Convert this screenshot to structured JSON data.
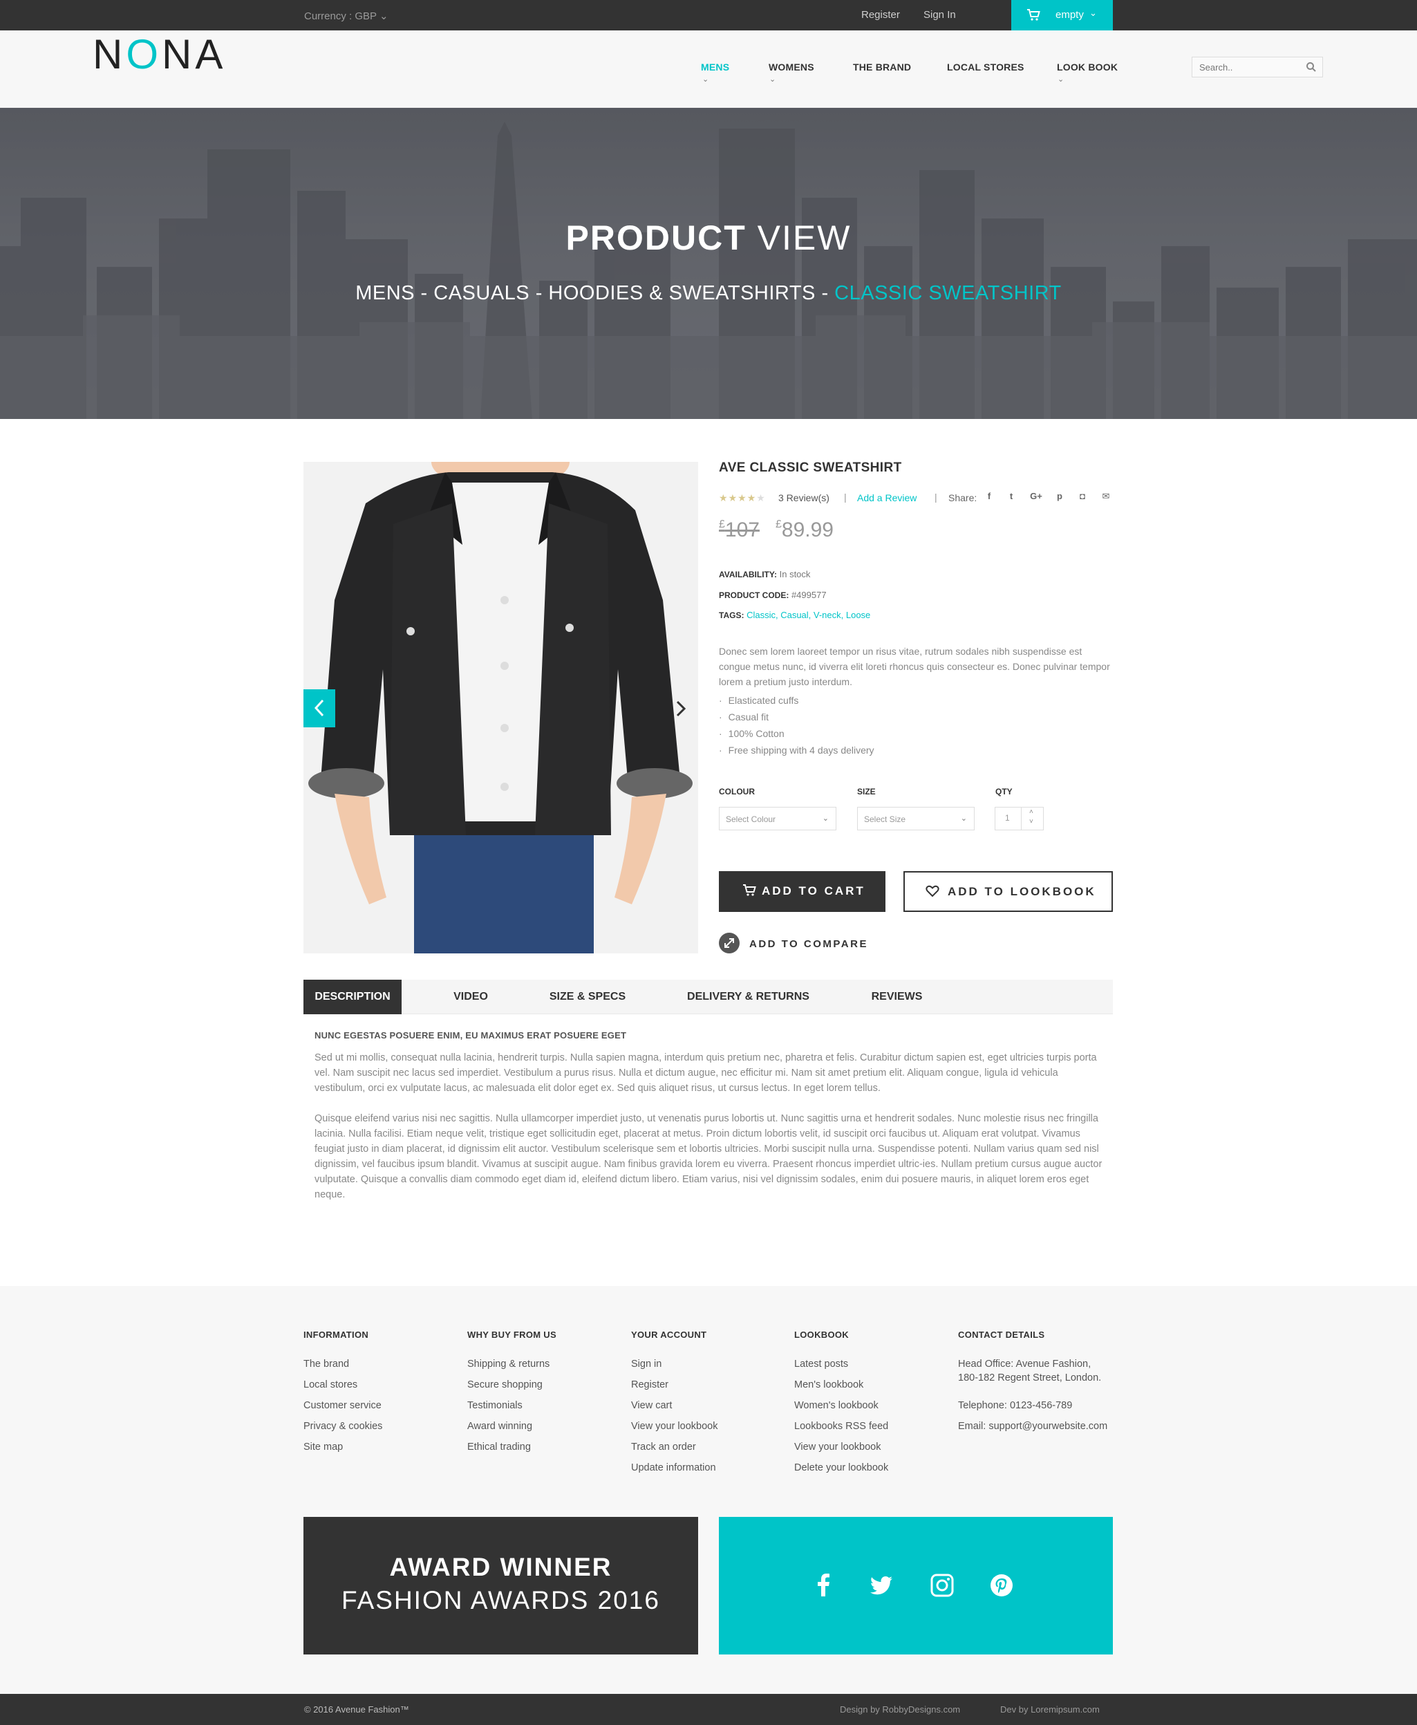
{
  "topbar": {
    "currency": "Currency : GBP",
    "register": "Register",
    "signin": "Sign In",
    "cart_label": "empty"
  },
  "header": {
    "logo": {
      "pre": "N",
      "o": "O",
      "post": "NA"
    },
    "nav": [
      {
        "label": "MENS",
        "active": true,
        "dropdown": true
      },
      {
        "label": "WOMENS",
        "active": false,
        "dropdown": true
      },
      {
        "label": "THE BRAND",
        "active": false,
        "dropdown": false
      },
      {
        "label": "LOCAL STORES",
        "active": false,
        "dropdown": false
      },
      {
        "label": "LOOK BOOK",
        "active": false,
        "dropdown": true
      }
    ],
    "search_placeholder": "Search.."
  },
  "hero": {
    "title_bold": "PRODUCT",
    "title_light": " VIEW",
    "breadcrumb": "MENS - CASUALS - HOODIES & SWEATSHIRTS - ",
    "breadcrumb_current": "CLASSIC SWEATSHIRT"
  },
  "product": {
    "title": "AVE CLASSIC SWEATSHIRT",
    "rating": 4,
    "rating_max": 5,
    "review_count": "3 Review(s)",
    "add_review": "Add a Review",
    "share_label": "Share:",
    "share_icons": [
      "facebook-icon",
      "twitter-icon",
      "google-plus-icon",
      "pinterest-icon",
      "instagram-icon",
      "email-icon"
    ],
    "share_glyphs": [
      "f",
      "t",
      "G+",
      "p",
      "◘",
      "✉"
    ],
    "currency_symbol": "£",
    "old_price": "107",
    "new_price": "89.99",
    "availability_label": "AVAILABILITY:",
    "availability_value": " In stock",
    "code_label": "PRODUCT CODE:",
    "code_value": " #499577",
    "tags_label": "TAGS:",
    "tags": "Classic, Casual, V-neck, Loose",
    "description": "Donec sem lorem laoreet tempor un risus vitae, rutrum sodales nibh suspendisse est congue metus nunc, id viverra elit loreti rhoncus quis consecteur es. Donec pulvinar tempor lorem a pretium justo interdum.",
    "features": [
      "Elasticated cuffs",
      "Casual fit",
      "100% Cotton",
      "Free shipping with 4 days delivery"
    ],
    "colour_label": "COLOUR",
    "colour_placeholder": "Select Colour",
    "size_label": "SIZE",
    "size_placeholder": "Select Size",
    "qty_label": "QTY",
    "qty_value": "1",
    "add_to_cart": "ADD TO CART",
    "add_to_lookbook": "ADD TO LOOKBOOK",
    "add_to_compare": "ADD TO COMPARE"
  },
  "tabs": [
    {
      "label": "DESCRIPTION",
      "active": true
    },
    {
      "label": "VIDEO",
      "active": false
    },
    {
      "label": "SIZE & SPECS",
      "active": false
    },
    {
      "label": "DELIVERY & RETURNS",
      "active": false
    },
    {
      "label": "REVIEWS",
      "active": false
    }
  ],
  "description_tab": {
    "heading": "NUNC EGESTAS POSUERE ENIM, EU MAXIMUS ERAT POSUERE EGET",
    "para1": "Sed ut mi mollis, consequat nulla lacinia, hendrerit turpis. Nulla sapien magna, interdum quis pretium nec, pharetra et felis. Curabitur dictum sapien est, eget ultricies turpis porta vel. Nam suscipit nec lacus sed imperdiet. Vestibulum a purus risus. Nulla et dictum augue, nec efficitur mi. Nam sit amet pretium elit. Aliquam congue, ligula id vehicula vestibulum, orci ex vulputate lacus, ac malesuada elit dolor eget ex. Sed quis aliquet risus, ut cursus lectus. In eget lorem tellus.",
    "para2": "Quisque eleifend varius nisi nec sagittis. Nulla ullamcorper imperdiet justo, ut venenatis purus lobortis ut. Nunc sagittis urna et hendrerit sodales. Nunc molestie risus nec fringilla lacinia. Nulla facilisi. Etiam neque velit, tristique eget sollicitudin eget, placerat at metus. Proin dictum lobortis velit, id suscipit orci faucibus ut. Aliquam erat volutpat. Vivamus feugiat justo in diam placerat, id dignissim elit auctor. Vestibulum scelerisque sem et lobortis ultricies. Morbi suscipit nulla urna. Suspendisse potenti. Nullam varius quam sed nisl dignissim, vel faucibus ipsum blandit. Vivamus at suscipit augue. Nam finibus gravida lorem eu viverra. Praesent rhoncus imperdiet ultric-ies. Nullam pretium cursus augue auctor vulputate. Quisque a convallis diam commodo eget diam id, eleifend dictum libero. Etiam varius, nisi vel dignissim sodales, enim dui posuere mauris, in aliquet lorem eros eget neque."
  },
  "footer": {
    "columns": [
      {
        "title": "INFORMATION",
        "links": [
          "The brand",
          "Local stores",
          "Customer service",
          "Privacy & cookies",
          "Site map"
        ]
      },
      {
        "title": "WHY BUY FROM US",
        "links": [
          "Shipping & returns",
          "Secure shopping",
          "Testimonials",
          "Award winning",
          "Ethical trading"
        ]
      },
      {
        "title": "YOUR ACCOUNT",
        "links": [
          "Sign in",
          "Register",
          "View cart",
          "View your lookbook",
          "Track an order",
          "Update information"
        ]
      },
      {
        "title": "LOOKBOOK",
        "links": [
          "Latest posts",
          "Men's lookbook",
          "Women's lookbook",
          "Lookbooks RSS feed",
          "View your lookbook",
          "Delete your lookbook"
        ]
      }
    ],
    "contact": {
      "title": "CONTACT DETAILS",
      "address1": "Head Office: Avenue Fashion,",
      "address2": "180-182 Regent Street, London.",
      "telephone": "Telephone: 0123-456-789",
      "email": "Email: support@yourwebsite.com"
    },
    "award_line1": "AWARD WINNER",
    "award_line2": "FASHION AWARDS 2016",
    "social_icons": [
      "facebook-icon",
      "twitter-icon",
      "instagram-icon",
      "pinterest-icon"
    ],
    "copyright": "© 2016 Avenue Fashion™",
    "design_by": "Design by RobbyDesigns.com",
    "dev_by": "Dev by Loremipsum.com"
  },
  "colors": {
    "accent": "#00c4c8",
    "dark": "#333333",
    "footer_bg": "#f7f7f7"
  }
}
